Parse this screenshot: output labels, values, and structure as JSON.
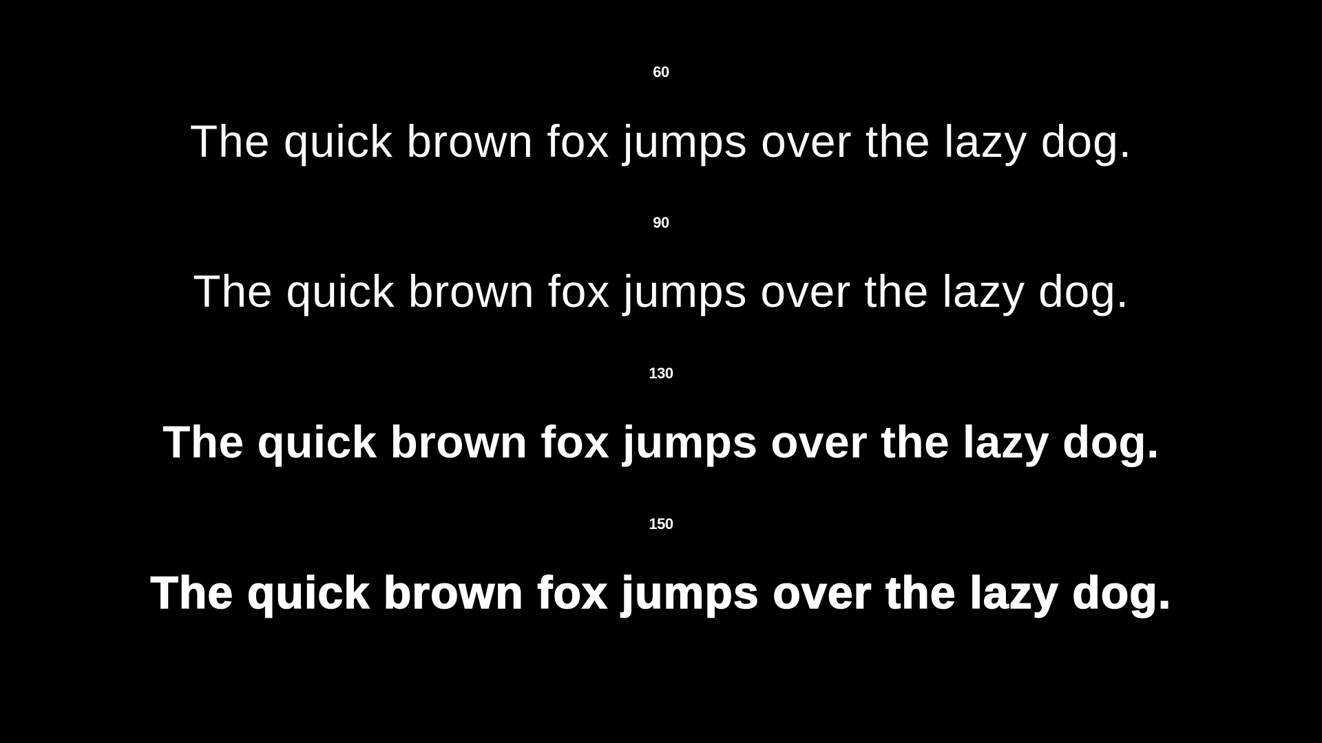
{
  "specimens": [
    {
      "label": "60",
      "text": "The quick brown fox jumps over the lazy dog."
    },
    {
      "label": "90",
      "text": "The quick brown fox jumps over the lazy dog."
    },
    {
      "label": "130",
      "text": "The quick brown fox jumps over the lazy dog."
    },
    {
      "label": "150",
      "text": "The quick brown fox jumps over the lazy dog."
    }
  ],
  "colors": {
    "background": "#000000",
    "text": "#ffffff"
  }
}
